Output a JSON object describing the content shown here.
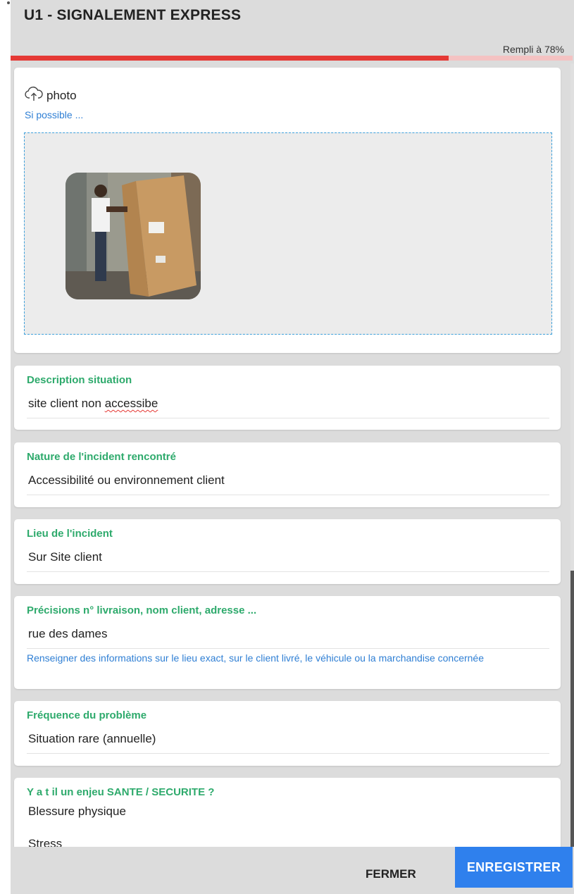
{
  "header": {
    "title": "U1 - SIGNALEMENT EXPRESS"
  },
  "progress": {
    "label": "Rempli à 78%",
    "fraction": 0.78
  },
  "photo": {
    "label": "photo",
    "hint": "Si possible ...",
    "icon": "cloud-upload-icon"
  },
  "fields": {
    "description": {
      "label": "Description situation",
      "value_prefix": "site client non ",
      "value_misspelled": "accessibe"
    },
    "nature": {
      "label": "Nature de l'incident rencontré",
      "value": "Accessibilité ou environnement client"
    },
    "lieu": {
      "label": "Lieu de l'incident",
      "value": "Sur Site client"
    },
    "precisions": {
      "label": "Précisions n° livraison, nom client, adresse ...",
      "value": "rue des dames",
      "helper": "Renseigner des informations sur le lieu exact, sur le client livré, le véhicule ou la marchandise concernée"
    },
    "frequence": {
      "label": "Fréquence du problème",
      "value": "Situation rare (annuelle)"
    },
    "enjeu": {
      "label": "Y a t il un enjeu SANTE / SECURITE ?",
      "options": [
        "Blessure physique",
        "Stress"
      ]
    }
  },
  "footer": {
    "close_label": "FERMER",
    "save_label": "ENREGISTRER"
  },
  "colors": {
    "accent_green": "#2eaa6c",
    "link_blue": "#2f7fd4",
    "progress_red": "#e53935",
    "save_blue": "#2f80ed"
  }
}
